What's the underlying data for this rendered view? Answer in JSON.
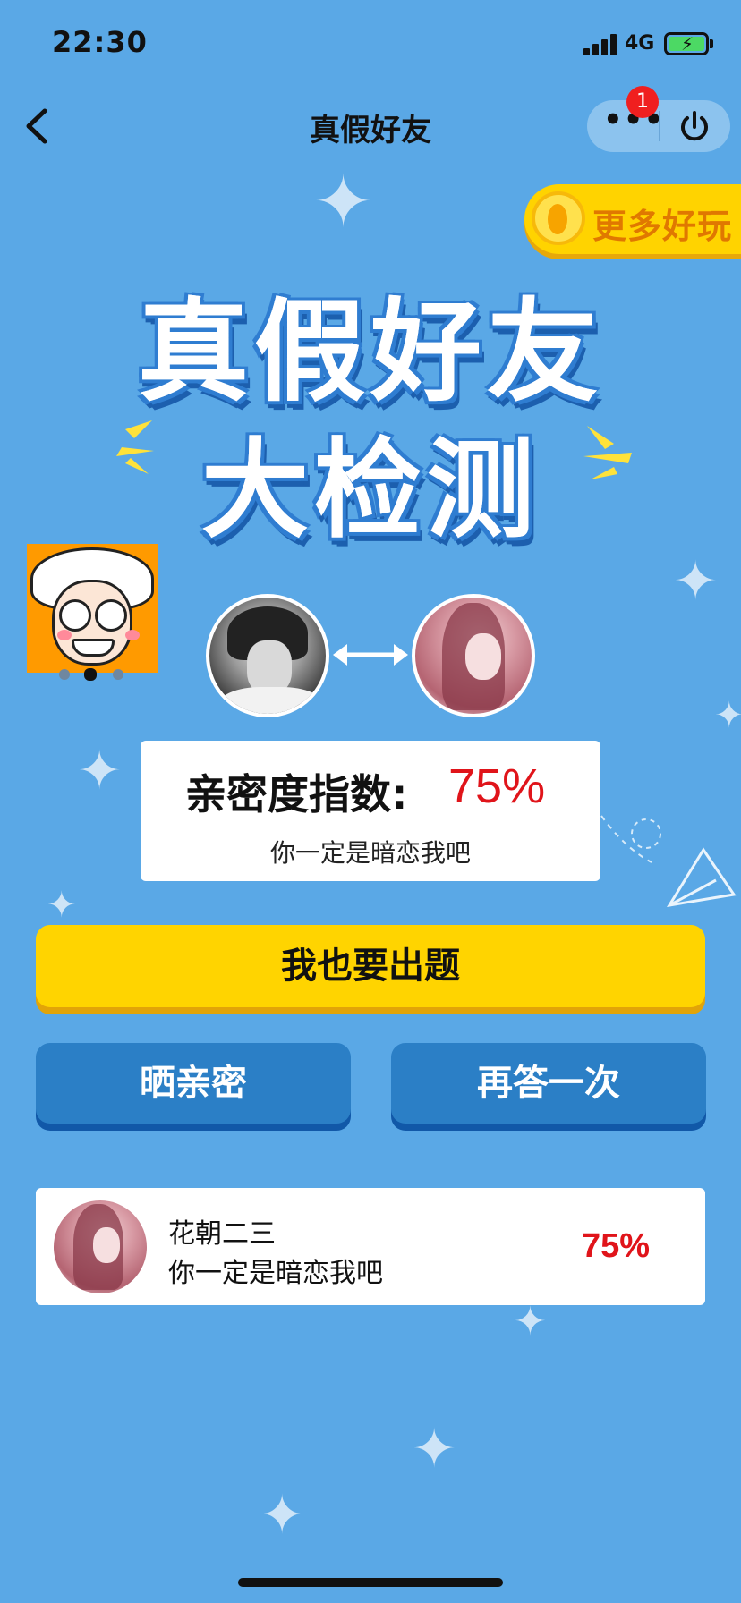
{
  "status_bar": {
    "time": "22:30",
    "network": "4G",
    "icons": [
      "signal-icon",
      "battery-charging-icon"
    ]
  },
  "nav": {
    "title": "真假好友",
    "back_icon": "chevron-left-icon",
    "more_icon": "more-dots-icon",
    "more_badge": "1",
    "power_icon": "power-icon"
  },
  "more_fun": {
    "label": "更多好玩",
    "icon": "coin-icon"
  },
  "hero": {
    "line1": "真假好友",
    "line2": "大检测"
  },
  "sticker": {
    "icon": "cartoon-old-man-avatar",
    "pager_count": 3,
    "pager_active": 1
  },
  "pair": {
    "swap_icon": "double-arrow-icon"
  },
  "score_card": {
    "label": "亲密度指数:",
    "value": "75%",
    "message": "你一定是暗恋我吧"
  },
  "actions": {
    "primary_label": "我也要出题",
    "share_label": "晒亲密",
    "retry_label": "再答一次"
  },
  "records": [
    {
      "name": "花朝二三",
      "message": "你一定是暗恋我吧",
      "score": "75%"
    }
  ],
  "colors": {
    "background": "#5aa8e6",
    "accent_yellow": "#ffd400",
    "button_blue": "#2b7fc6",
    "score_red": "#e0141a"
  }
}
